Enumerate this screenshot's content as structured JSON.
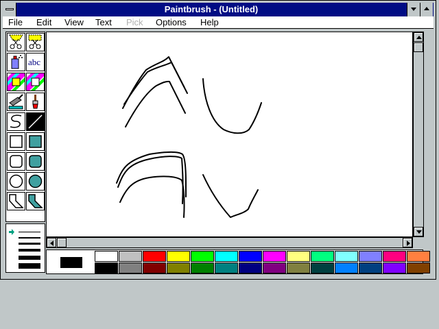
{
  "window": {
    "title": "Paintbrush - (Untitled)"
  },
  "menu": [
    {
      "label": "File",
      "enabled": true
    },
    {
      "label": "Edit",
      "enabled": true
    },
    {
      "label": "View",
      "enabled": true
    },
    {
      "label": "Text",
      "enabled": true
    },
    {
      "label": "Pick",
      "enabled": false
    },
    {
      "label": "Options",
      "enabled": true
    },
    {
      "label": "Help",
      "enabled": true
    }
  ],
  "toolbox": {
    "tools": [
      "scissors-icon",
      "pick-icon",
      "airbrush-icon",
      "text-icon",
      "color-eraser-icon",
      "eraser-icon",
      "paint-roller-icon",
      "brush-icon",
      "curve-icon",
      "line-icon",
      "box-icon",
      "filled-box-icon",
      "rounded-box-icon",
      "filled-rounded-box-icon",
      "circle-icon",
      "filled-circle-icon",
      "polygon-icon",
      "filled-polygon-icon"
    ],
    "text_tool_label": "abc"
  },
  "palette": {
    "foreground": "#000000",
    "background": "#ffffff",
    "colors": [
      "#ffffff",
      "#c0c0c0",
      "#ff0000",
      "#ffff00",
      "#00ff00",
      "#00ffff",
      "#0000ff",
      "#ff00ff",
      "#ffff80",
      "#00ff80",
      "#80ffff",
      "#8080ff",
      "#ff0080",
      "#ff8040",
      "#000000",
      "#808080",
      "#800000",
      "#808000",
      "#008000",
      "#008080",
      "#000080",
      "#800080",
      "#808040",
      "#004040",
      "#0080ff",
      "#004080",
      "#8000ff",
      "#804000"
    ]
  }
}
